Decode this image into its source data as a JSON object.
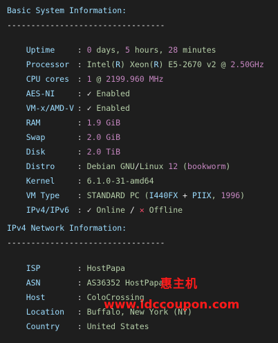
{
  "basic": {
    "heading": "Basic System Information:",
    "divider": "---------------------------------",
    "uptime": {
      "key": "Uptime",
      "v1": "0",
      "w1": " days, ",
      "v2": "5",
      "w2": " hours, ",
      "v3": "28",
      "w3": " minutes"
    },
    "processor": {
      "key": "Processor",
      "p1": "Intel(",
      "p2": "R",
      "p3": ") Xeon(",
      "p4": "R",
      "p5": ") E5-2670 v2 @ ",
      "p6": "2.50GHz"
    },
    "cpu_cores": {
      "key": "CPU cores",
      "c1": "1",
      "c2": " @ ",
      "c3": "2199.960 MHz"
    },
    "aes_ni": {
      "key": "AES-NI",
      "check": "✓",
      "val": " Enabled"
    },
    "vmx": {
      "key": "VM-x/AMD-V",
      "check": "✓",
      "val": " Enabled"
    },
    "ram": {
      "key": "RAM",
      "val": "1.9 GiB"
    },
    "swap": {
      "key": "Swap",
      "val": "2.0 GiB"
    },
    "disk": {
      "key": "Disk",
      "val": "2.0 TiB"
    },
    "distro": {
      "key": "Distro",
      "d1": "Debian GNU",
      "d2": "/",
      "d3": "Linux ",
      "d4": "12",
      "d5": " (",
      "d6": "bookworm",
      "d7": ")"
    },
    "kernel": {
      "key": "Kernel",
      "val": "6.1.0-31-amd64"
    },
    "vm_type": {
      "key": "VM Type",
      "t1": "STANDARD PC (",
      "t2": "I440FX",
      "t3": " + ",
      "t4": "PIIX",
      "t5": ", ",
      "t6": "1996",
      "t7": ")"
    },
    "ipv": {
      "key": "IPv4/IPv6",
      "check": "✓",
      "online": " Online ",
      "slash": "/",
      "cross": " ✕",
      "offline": " Offline"
    }
  },
  "network": {
    "heading": "IPv4 Network Information:",
    "divider": "---------------------------------",
    "isp": {
      "key": "ISP",
      "val": "HostPapa"
    },
    "asn": {
      "key": "ASN",
      "val": "AS36352 HostPapa"
    },
    "host": {
      "key": "Host",
      "val": "ColoCrossing"
    },
    "location": {
      "key": "Location",
      "val": "Buffalo, New York (NY)"
    },
    "country": {
      "key": "Country",
      "val": "United States"
    }
  },
  "separator": ": ",
  "watermark": {
    "brand": "惠主机",
    "url": "www.idccoupon.com",
    "color": "#ff1a1a"
  }
}
